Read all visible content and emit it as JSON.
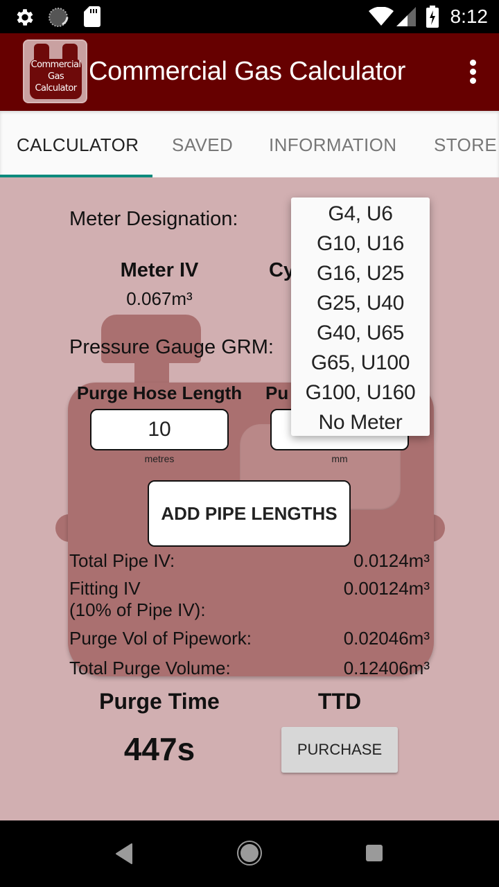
{
  "status_bar": {
    "left_icons": [
      "settings-icon",
      "sync-icon",
      "sd-card-icon"
    ],
    "right_icons": [
      "wifi-icon",
      "signal-icon",
      "battery-charging-icon"
    ],
    "time": "8:12"
  },
  "app_bar": {
    "logo_text": [
      "Commercial",
      "Gas",
      "Calculator"
    ],
    "title": "Commercial Gas Calculator",
    "menu_icon": "more-vert-icon"
  },
  "tabs": [
    {
      "label": "CALCULATOR",
      "active": true
    },
    {
      "label": "SAVED",
      "active": false
    },
    {
      "label": "INFORMATION",
      "active": false
    },
    {
      "label": "STORE",
      "active": false
    }
  ],
  "colors": {
    "app_bar": "#660000",
    "content_bg": "#d1afb1",
    "meter_shape": "#aa7070",
    "tab_indicator": "#0d8a7d"
  },
  "calculator": {
    "meter_designation_label": "Meter Designation:",
    "meter_iv_heading": "Meter IV",
    "meter_iv_value": "0.067m³",
    "cyl_heading_partial": "Cy",
    "pressure_gauge_label": "Pressure Gauge GRM:",
    "purge_hose_length_heading": "Purge Hose Length",
    "purge_hose_length_value": "10",
    "purge_hose_length_unit": "metres",
    "purge_second_heading_partial": "Pu",
    "purge_second_unit": "mm",
    "add_pipe_lengths_button": "ADD PIPE LENGTHS",
    "results": [
      {
        "label": "Total Pipe IV:",
        "value": "0.0124m³"
      },
      {
        "label": "Fitting IV\n(10% of Pipe IV):",
        "value": "0.00124m³"
      },
      {
        "label": "Purge Vol of Pipework:",
        "value": "0.02046m³"
      },
      {
        "label": "Total Purge Volume:",
        "value": "0.12406m³"
      }
    ],
    "purge_time_heading": "Purge Time",
    "purge_time_value": "447s",
    "ttd_heading": "TTD",
    "purchase_button": "PURCHASE"
  },
  "meter_dropdown": {
    "options": [
      "G4, U6",
      "G10, U16",
      "G16, U25",
      "G25, U40",
      "G40, U65",
      "G65, U100",
      "G100, U160",
      "No Meter"
    ]
  },
  "nav_bar": {
    "buttons": [
      "back-icon",
      "home-icon",
      "recents-icon"
    ]
  }
}
